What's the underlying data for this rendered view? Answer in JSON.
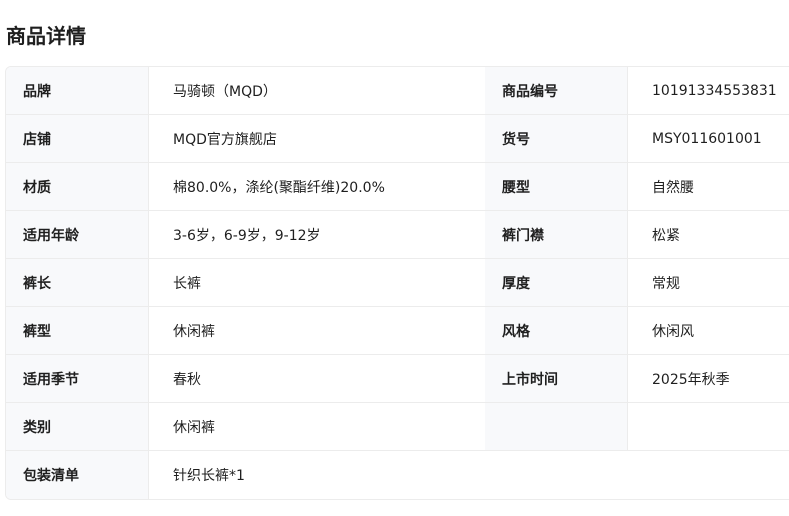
{
  "title": "商品详情",
  "rows": [
    {
      "l1": "品牌",
      "v1": "马骑顿（MQD）",
      "l2": "商品编号",
      "v2": "10191334553831"
    },
    {
      "l1": "店铺",
      "v1": "MQD官方旗舰店",
      "l2": "货号",
      "v2": "MSY011601001"
    },
    {
      "l1": "材质",
      "v1": "棉80.0%，涤纶(聚酯纤维)20.0%",
      "l2": "腰型",
      "v2": "自然腰"
    },
    {
      "l1": "适用年龄",
      "v1": "3-6岁，6-9岁，9-12岁",
      "l2": "裤门襟",
      "v2": "松紧"
    },
    {
      "l1": "裤长",
      "v1": "长裤",
      "l2": "厚度",
      "v2": "常规"
    },
    {
      "l1": "裤型",
      "v1": "休闲裤",
      "l2": "风格",
      "v2": "休闲风"
    },
    {
      "l1": "适用季节",
      "v1": "春秋",
      "l2": "上市时间",
      "v2": "2025年秋季"
    },
    {
      "l1": "类别",
      "v1": "休闲裤",
      "l2": "",
      "v2": ""
    }
  ],
  "last": {
    "label": "包装清单",
    "value": "针织长裤*1"
  }
}
